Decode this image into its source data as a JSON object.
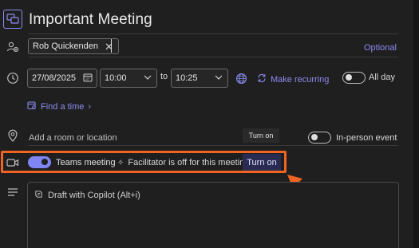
{
  "title": "Important Meeting",
  "attendees": [
    {
      "name": "Rob Quickenden"
    }
  ],
  "optional_label": "Optional",
  "start_date": "27/08/2025",
  "start_time": "10:00",
  "to_label": "to",
  "end_time": "10:25",
  "make_recurring": "Make recurring",
  "all_day_label": "All day",
  "all_day_on": false,
  "find_time_label": "Find a time",
  "location_placeholder": "Add a room or location",
  "in_person_label": "In-person event",
  "in_person_on": false,
  "tooltip_text": "Turn on",
  "teams_meeting_label": "Teams meeting",
  "teams_meeting_on": true,
  "facilitator_text": "Facilitator is off for this meeting.",
  "turn_on_button": "Turn on",
  "copilot_placeholder": "Draft with Copilot (Alt+i)",
  "colors": {
    "accent": "#7f85f5",
    "link": "#8b8cf0",
    "highlight": "#f06423",
    "background": "#1f1f1f"
  }
}
